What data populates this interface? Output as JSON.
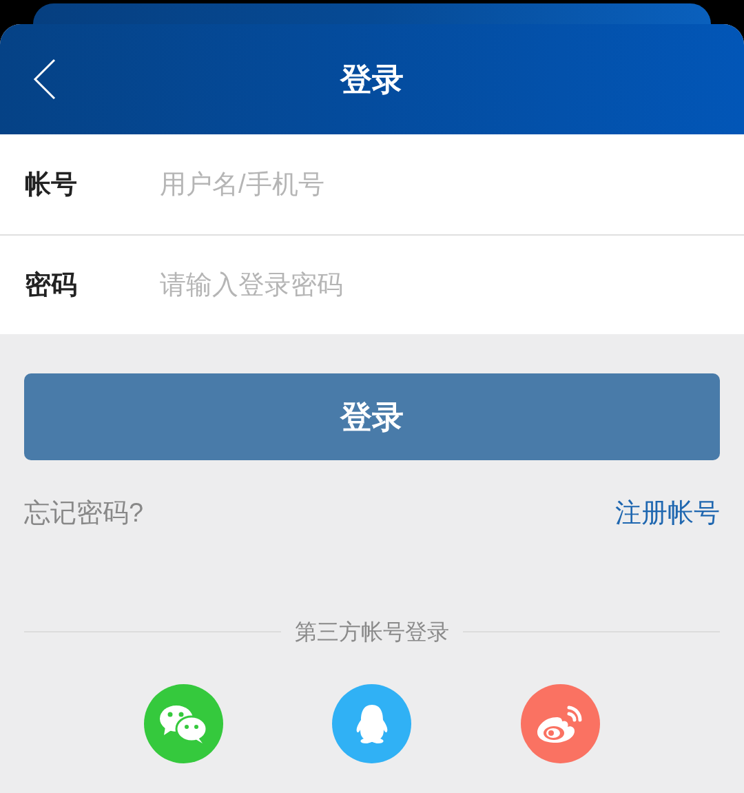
{
  "header": {
    "title": "登录"
  },
  "fields": [
    {
      "label": "帐号",
      "placeholder": "用户名/手机号"
    },
    {
      "label": "密码",
      "placeholder": "请输入登录密码"
    }
  ],
  "login_button": "登录",
  "forgot_link": "忘记密码?",
  "register_link": "注册帐号",
  "third_party": {
    "title": "第三方帐号登录",
    "providers": [
      {
        "kind": "chat",
        "color": "#35c93d"
      },
      {
        "kind": "penguin",
        "color": "#30b1f5"
      },
      {
        "kind": "eye",
        "color": "#fa7262"
      }
    ]
  }
}
